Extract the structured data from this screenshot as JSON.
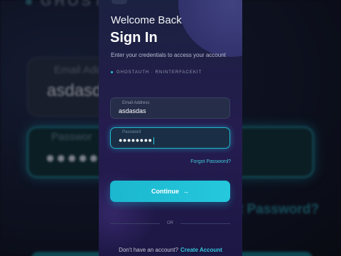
{
  "background": {
    "brand": "GHOSTAU",
    "email_label": "Email Add",
    "email_value": "asdasda",
    "password_label": "Passwor",
    "password_value": "●●●●●●●",
    "forgot_fragment": "t Password?"
  },
  "header": {
    "welcome": "Welcome Back",
    "title": "Sign In",
    "subtitle": "Enter your credentials to access your account",
    "brand_line": "GHOSTAUTH · RNINTERFACEKIT"
  },
  "form": {
    "email": {
      "label": "Email Address",
      "value": "asdasdas"
    },
    "password": {
      "label": "Password",
      "value": "●●●●●●●●"
    },
    "forgot_label": "Forgot Password?",
    "continue_label": "Continue",
    "or_label": "OR"
  },
  "footer": {
    "question": "Don't have an account?",
    "create_label": "Create Account"
  },
  "colors": {
    "accent": "#25c8dd",
    "card_bg": "#1c1744"
  }
}
